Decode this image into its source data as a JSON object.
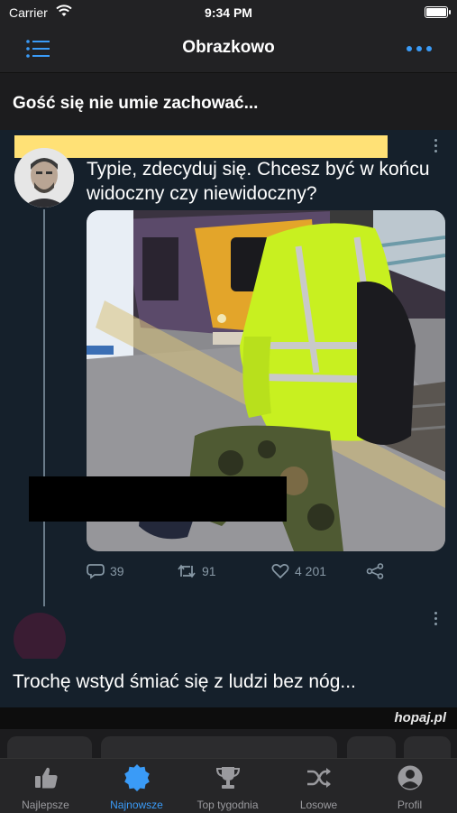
{
  "status_bar": {
    "carrier": "Carrier",
    "time": "9:34 PM"
  },
  "header": {
    "title": "Obrazkowo",
    "menu_icon": "list-icon",
    "more_icon": "ellipsis-icon"
  },
  "post": {
    "title": "Gość się nie umie zachować..."
  },
  "tweet": {
    "text": "Typie, zdecyduj się. Chcesz być w końcu widoczny czy niewidoczny?",
    "replies": "39",
    "retweets": "91",
    "likes": "4 201"
  },
  "next_post": {
    "caption": "Trochę wstyd śmiać się z ludzi bez nóg..."
  },
  "watermark": "hopaj.pl",
  "tabs": [
    {
      "label": "Najlepsze",
      "icon": "thumbs-up-icon"
    },
    {
      "label": "Najnowsze",
      "icon": "badge-star-icon",
      "active": true
    },
    {
      "label": "Top tygodnia",
      "icon": "trophy-icon"
    },
    {
      "label": "Losowe",
      "icon": "shuffle-icon"
    },
    {
      "label": "Profil",
      "icon": "person-icon"
    }
  ],
  "colors": {
    "accent": "#3a9bf7",
    "tweet_bg": "#15202b",
    "highlight_bar": "#ffe176",
    "jacket": "#c8f020"
  }
}
